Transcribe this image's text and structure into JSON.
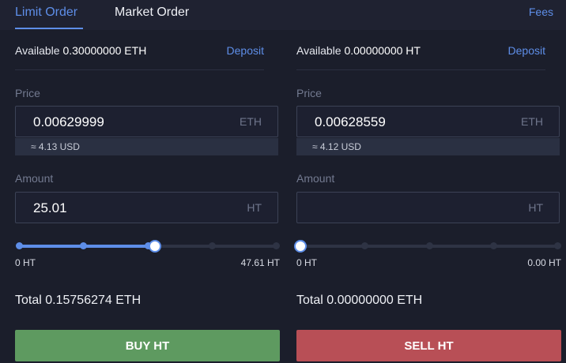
{
  "tabs": [
    {
      "label": "Limit Order",
      "active": true
    },
    {
      "label": "Market Order",
      "active": false
    }
  ],
  "fees_label": "Fees",
  "colors": {
    "accent": "#5e8ee8",
    "buy": "#5e9a60",
    "sell": "#b84f56"
  },
  "buy": {
    "available_label": "Available",
    "available_value": "0.30000000 ETH",
    "deposit_label": "Deposit",
    "price_label": "Price",
    "price_value": "0.00629999",
    "price_unit": "ETH",
    "price_approx": "≈ 4.13 USD",
    "amount_label": "Amount",
    "amount_value": "25.01",
    "amount_unit": "HT",
    "slider_percent": 53,
    "slider_min": "0 HT",
    "slider_max": "47.61 HT",
    "total_label": "Total",
    "total_value": "0.15756274 ETH",
    "button_label": "BUY HT"
  },
  "sell": {
    "available_label": "Available",
    "available_value": "0.00000000 HT",
    "deposit_label": "Deposit",
    "price_label": "Price",
    "price_value": "0.00628559",
    "price_unit": "ETH",
    "price_approx": "≈ 4.12 USD",
    "amount_label": "Amount",
    "amount_value": "",
    "amount_unit": "HT",
    "slider_percent": 0,
    "slider_min": "0 HT",
    "slider_max": "0.00 HT",
    "total_label": "Total",
    "total_value": "0.00000000 ETH",
    "button_label": "SELL HT"
  }
}
